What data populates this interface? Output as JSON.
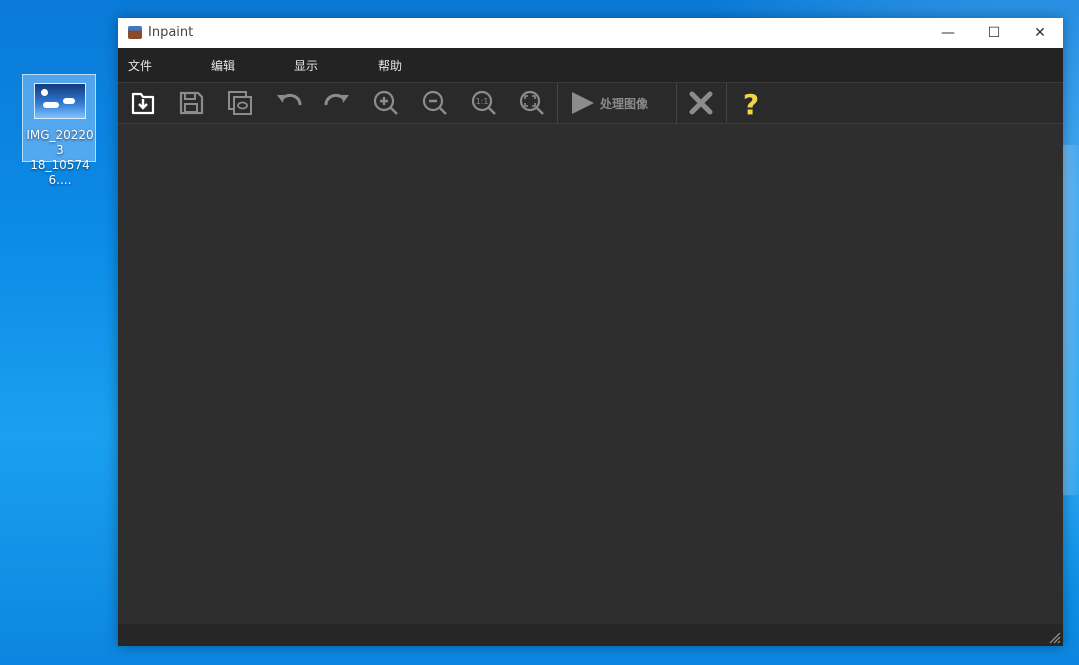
{
  "desktop": {
    "icon_label_line1": "IMG_202203",
    "icon_label_line2": "18_105746...."
  },
  "window": {
    "title": "Inpaint",
    "controls": {
      "minimize": "—",
      "maximize": "☐",
      "close": "✕"
    }
  },
  "menu": {
    "items": [
      "文件",
      "编辑",
      "显示",
      "帮助"
    ]
  },
  "toolbar": {
    "process_label": "处理图像",
    "icons": [
      "open-file-icon",
      "save-icon",
      "save-as-icon",
      "undo-icon",
      "redo-icon",
      "zoom-in-icon",
      "zoom-out-icon",
      "zoom-actual-size-icon",
      "zoom-fit-icon",
      "play-icon",
      "clear-x-icon",
      "help-question-icon"
    ],
    "colors": {
      "help_icon": "#f2d649",
      "active_icon": "#ffffff",
      "disabled_icon": "#8c8c8c"
    }
  },
  "colors": {
    "window_bg": "#2d2d2d",
    "menubar_bg": "#232323",
    "desktop_bg": "#0b8be6"
  }
}
